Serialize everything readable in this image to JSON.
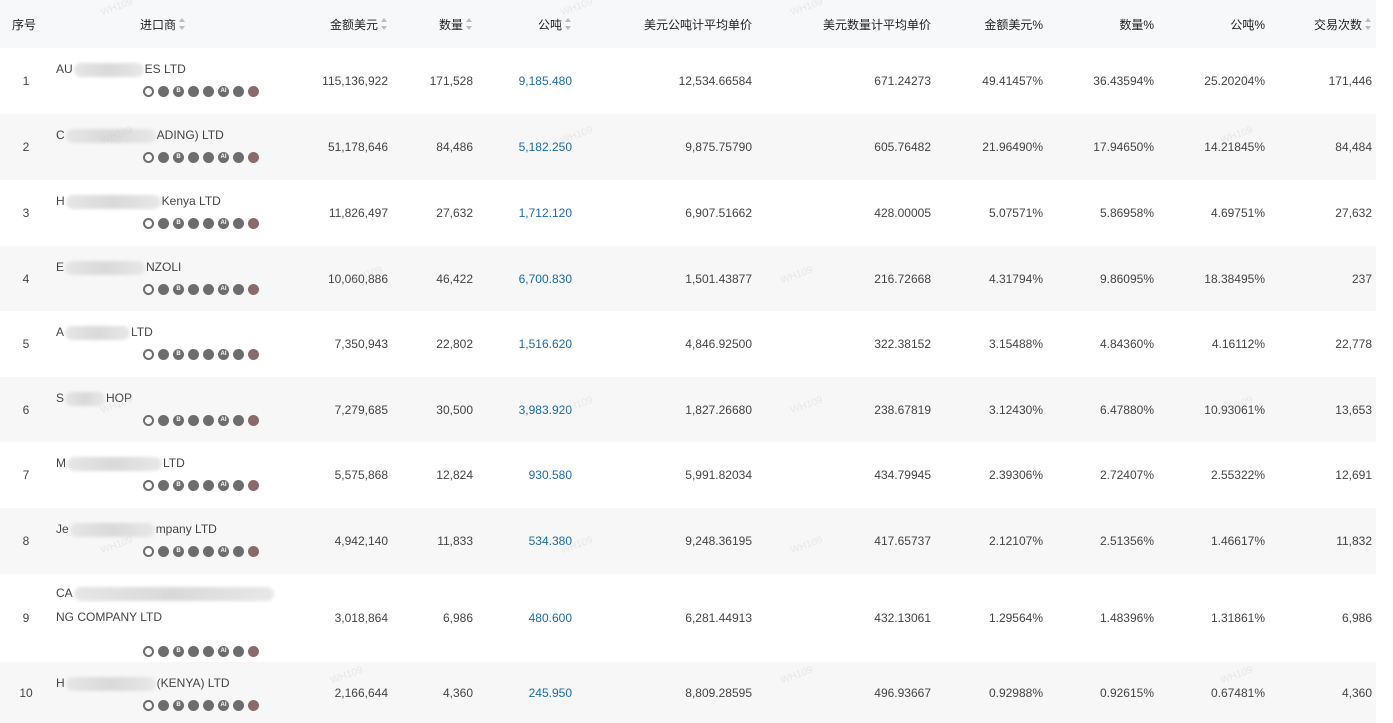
{
  "header": {
    "seq": "序号",
    "importer": "进口商",
    "usd": "金额美元",
    "qty": "数量",
    "ton": "公吨",
    "price_per_ton": "美元公吨计平均单价",
    "price_per_qty": "美元数量计平均单价",
    "usd_pct": "金额美元%",
    "qty_pct": "数量%",
    "ton_pct": "公吨%",
    "txn": "交易次数"
  },
  "icon_names": [
    "target-icon",
    "compass-icon",
    "b-badge-icon",
    "circle-dot-icon",
    "globe-icon",
    "ai-icon",
    "people-icon",
    "record-icon"
  ],
  "rows": [
    {
      "seq": "1",
      "name_pre": "AU",
      "name_post": "ES LTD",
      "usd": "115,136,922",
      "qty": "171,528",
      "ton": "9,185.480",
      "ptu": "12,534.66584",
      "pqu": "671.24273",
      "usdp": "49.41457%",
      "qtyp": "36.43594%",
      "tonp": "25.20204%",
      "txn": "171,446"
    },
    {
      "seq": "2",
      "name_pre": "C",
      "name_post": "ADING) LTD",
      "usd": "51,178,646",
      "qty": "84,486",
      "ton": "5,182.250",
      "ptu": "9,875.75790",
      "pqu": "605.76482",
      "usdp": "21.96490%",
      "qtyp": "17.94650%",
      "tonp": "14.21845%",
      "txn": "84,484"
    },
    {
      "seq": "3",
      "name_pre": "H",
      "name_post": "Kenya LTD",
      "usd": "11,826,497",
      "qty": "27,632",
      "ton": "1,712.120",
      "ptu": "6,907.51662",
      "pqu": "428.00005",
      "usdp": "5.07571%",
      "qtyp": "5.86958%",
      "tonp": "4.69751%",
      "txn": "27,632"
    },
    {
      "seq": "4",
      "name_pre": "E",
      "name_post": "NZOLI",
      "usd": "10,060,886",
      "qty": "46,422",
      "ton": "6,700.830",
      "ptu": "1,501.43877",
      "pqu": "216.72668",
      "usdp": "4.31794%",
      "qtyp": "9.86095%",
      "tonp": "18.38495%",
      "txn": "237"
    },
    {
      "seq": "5",
      "name_pre": "A",
      "name_post": "LTD",
      "usd": "7,350,943",
      "qty": "22,802",
      "ton": "1,516.620",
      "ptu": "4,846.92500",
      "pqu": "322.38152",
      "usdp": "3.15488%",
      "qtyp": "4.84360%",
      "tonp": "4.16112%",
      "txn": "22,778"
    },
    {
      "seq": "6",
      "name_pre": "S",
      "name_post": "HOP",
      "usd": "7,279,685",
      "qty": "30,500",
      "ton": "3,983.920",
      "ptu": "1,827.26680",
      "pqu": "238.67819",
      "usdp": "3.12430%",
      "qtyp": "6.47880%",
      "tonp": "10.93061%",
      "txn": "13,653"
    },
    {
      "seq": "7",
      "name_pre": "M",
      "name_post": "LTD",
      "usd": "5,575,868",
      "qty": "12,824",
      "ton": "930.580",
      "ptu": "5,991.82034",
      "pqu": "434.79945",
      "usdp": "2.39306%",
      "qtyp": "2.72407%",
      "tonp": "2.55322%",
      "txn": "12,691"
    },
    {
      "seq": "8",
      "name_pre": "Je",
      "name_post": "mpany LTD",
      "usd": "4,942,140",
      "qty": "11,833",
      "ton": "534.380",
      "ptu": "9,248.36195",
      "pqu": "417.65737",
      "usdp": "2.12107%",
      "qtyp": "2.51356%",
      "tonp": "1.46617%",
      "txn": "11,832"
    },
    {
      "seq": "9",
      "name_pre": "CA",
      "name_post": "",
      "name_line2": "NG COMPANY LTD",
      "usd": "3,018,864",
      "qty": "6,986",
      "ton": "480.600",
      "ptu": "6,281.44913",
      "pqu": "432.13061",
      "usdp": "1.29564%",
      "qtyp": "1.48396%",
      "tonp": "1.31861%",
      "txn": "6,986"
    },
    {
      "seq": "10",
      "name_pre": "H",
      "name_post": "(KENYA) LTD",
      "usd": "2,166,644",
      "qty": "4,360",
      "ton": "245.950",
      "ptu": "8,809.28595",
      "pqu": "496.93667",
      "usdp": "0.92988%",
      "qtyp": "0.92615%",
      "tonp": "0.67481%",
      "txn": "4,360"
    }
  ],
  "watermark": "WH109"
}
